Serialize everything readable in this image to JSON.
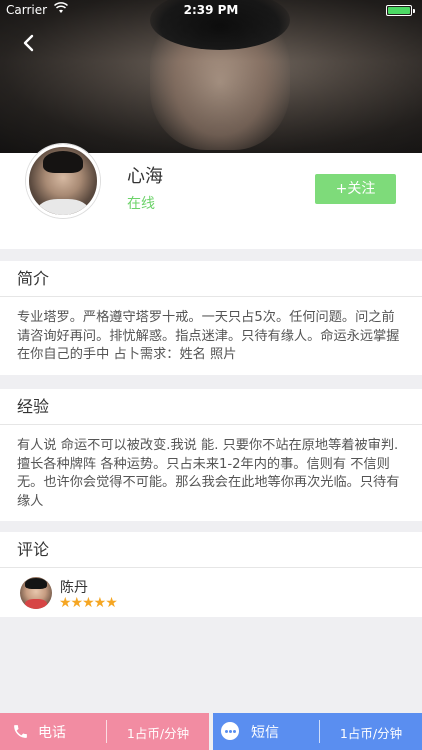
{
  "status_bar": {
    "carrier": "Carrier",
    "time": "2:39 PM",
    "wifi_icon": "wifi-icon",
    "battery_icon": "battery-icon"
  },
  "nav": {
    "back_icon": "chevron-left-icon"
  },
  "profile": {
    "name": "心海",
    "status": "在线",
    "follow_label": "+关注"
  },
  "intro": {
    "title": "简介",
    "text": "专业塔罗。严格遵守塔罗十戒。一天只占5次。任何问题。问之前请咨询好再问。排忧解惑。指点迷津。只待有缘人。命运永远掌握在你自己的手中 占卜需求：姓名 照片"
  },
  "experience": {
    "title": "经验",
    "text": "有人说 命运不可以被改变.我说 能. 只要你不站在原地等着被审判. 擅长各种牌阵 各种运势。只占未来1-2年内的事。信则有 不信则无。也许你会觉得不可能。那么我会在此地等你再次光临。只待有缘人"
  },
  "reviews": {
    "title": "评论",
    "items": [
      {
        "name": "陈丹",
        "stars": "★★★★★",
        "rating": 5
      }
    ]
  },
  "bottom_bar": {
    "call": {
      "label": "电话",
      "price": "1占币/分钟",
      "icon": "phone-icon",
      "color": "#f28ca2"
    },
    "sms": {
      "label": "短信",
      "price": "1占币/分钟",
      "icon": "chat-bubble-icon",
      "color": "#5a8ef0"
    }
  },
  "colors": {
    "accent_green": "#7edb7a",
    "online_green": "#6dd36a",
    "star": "#f5a623"
  }
}
